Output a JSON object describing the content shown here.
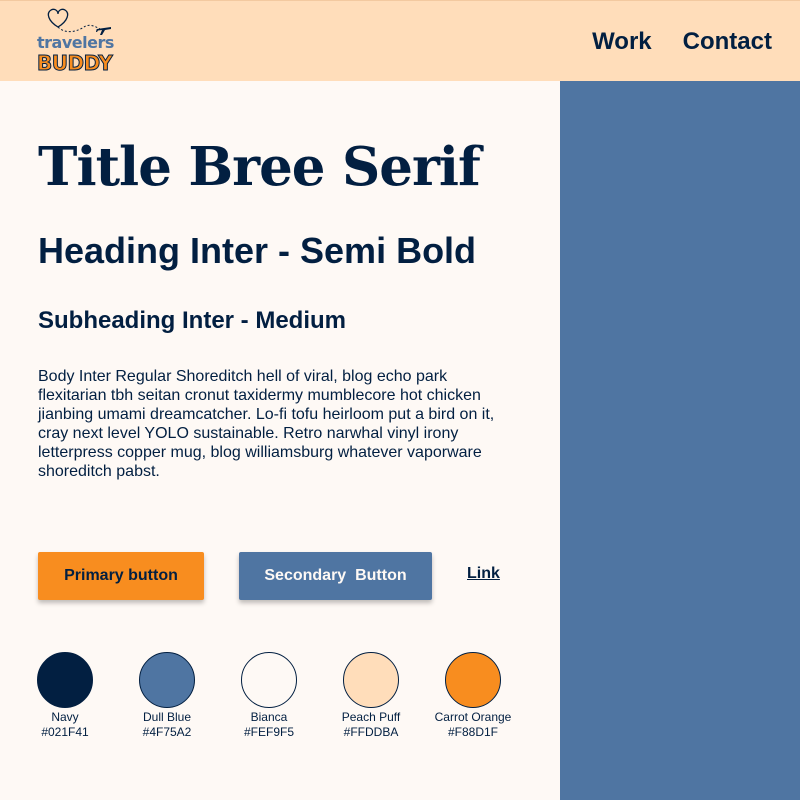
{
  "header": {
    "logo": {
      "word1": "travelers",
      "word2": "BUDDY"
    },
    "nav": [
      {
        "label": "Work"
      },
      {
        "label": "Contact"
      }
    ]
  },
  "main": {
    "title": "Title Bree Serif",
    "heading": "Heading Inter - Semi Bold",
    "subheading": "Subheading Inter - Medium",
    "body": "Body Inter Regular Shoreditch hell of viral, blog echo park flexitarian tbh seitan cronut taxidermy mumblecore hot chicken jianbing umami dreamcatcher. Lo-fi tofu heirloom put a bird on it, cray next level YOLO sustainable. Retro narwhal vinyl irony letterpress copper mug, blog williamsburg whatever vaporware shoreditch pabst.",
    "buttons": {
      "primary": "Primary button",
      "secondary": "Secondary  Button",
      "link": "Link"
    }
  },
  "swatches": [
    {
      "name": "Navy",
      "hex": "#021F41",
      "color": "#021F41"
    },
    {
      "name": "Dull Blue",
      "hex": "#4F75A2",
      "color": "#4F75A2"
    },
    {
      "name": "Bianca",
      "hex": "#FEF9F5",
      "color": "#FEF9F5"
    },
    {
      "name": "Peach Puff",
      "hex": "#FFDDBA",
      "color": "#FFDDBA"
    },
    {
      "name": "Carrot Orange",
      "hex": "#F88D1F",
      "color": "#F88D1F"
    }
  ],
  "colors": {
    "navy": "#021F41",
    "dull_blue": "#4F75A2",
    "bianca": "#FEF9F5",
    "peach_puff": "#FFDDBA",
    "carrot_orange": "#F88D1F"
  },
  "icons": [
    "heart-icon",
    "airplane-icon"
  ]
}
